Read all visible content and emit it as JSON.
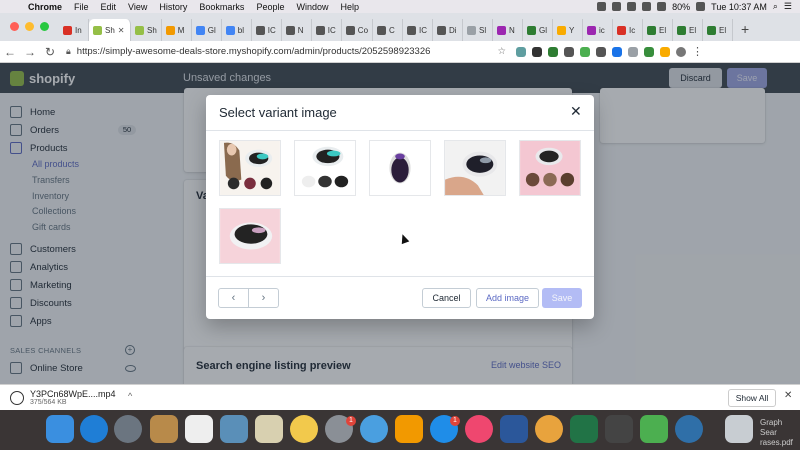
{
  "menubar": {
    "app": "Chrome",
    "items": [
      "File",
      "Edit",
      "View",
      "History",
      "Bookmarks",
      "People",
      "Window",
      "Help"
    ],
    "battery": "80%",
    "clock": "Tue 10:37 AM"
  },
  "browser": {
    "tabs": [
      {
        "label": "In",
        "color": "#d93025"
      },
      {
        "label": "Sh",
        "color": "#95bf47",
        "active": true
      },
      {
        "label": "Sh",
        "color": "#95bf47"
      },
      {
        "label": "M",
        "color": "#f29900"
      },
      {
        "label": "Gl",
        "color": "#4285f4"
      },
      {
        "label": "bl",
        "color": "#4285f4"
      },
      {
        "label": "IC",
        "color": "#555555"
      },
      {
        "label": "N",
        "color": "#555555"
      },
      {
        "label": "IC",
        "color": "#555555"
      },
      {
        "label": "Co",
        "color": "#555555"
      },
      {
        "label": "C",
        "color": "#555555"
      },
      {
        "label": "IC",
        "color": "#555555"
      },
      {
        "label": "Di",
        "color": "#555555"
      },
      {
        "label": "Sl",
        "color": "#9aa0a6"
      },
      {
        "label": "N",
        "color": "#9c27b0"
      },
      {
        "label": "Gl",
        "color": "#2e7d32"
      },
      {
        "label": "Y",
        "color": "#f9ab00"
      },
      {
        "label": "ic",
        "color": "#9c27b0"
      },
      {
        "label": "Ic",
        "color": "#d93025"
      },
      {
        "label": "El",
        "color": "#2e7d32"
      },
      {
        "label": "El",
        "color": "#2e7d32"
      },
      {
        "label": "El",
        "color": "#2e7d32"
      }
    ],
    "url": "https://simply-awesome-deals-store.myshopify.com/admin/products/2052598923326"
  },
  "shopify": {
    "logo": "shopify",
    "header_status": "Unsaved changes",
    "discard": "Discard",
    "save": "Save",
    "nav": {
      "home": "Home",
      "orders": "Orders",
      "orders_count": "50",
      "products": "Products",
      "all_products": "All products",
      "transfers": "Transfers",
      "inventory": "Inventory",
      "collections": "Collections",
      "gift_cards": "Gift cards",
      "customers": "Customers",
      "analytics": "Analytics",
      "marketing": "Marketing",
      "discounts": "Discounts",
      "apps": "Apps",
      "sales_channels": "SALES CHANNELS",
      "online_store": "Online Store"
    },
    "variants_heading": "Va",
    "seo_title": "Search engine listing preview",
    "seo_link": "Edit website SEO"
  },
  "modal": {
    "title": "Select variant image",
    "cancel": "Cancel",
    "add_image": "Add image",
    "save": "Save",
    "images": [
      {
        "name": "hair-model-brushes"
      },
      {
        "name": "three-brushes-teal"
      },
      {
        "name": "brush-oval-dark"
      },
      {
        "name": "brush-in-hand"
      },
      {
        "name": "brush-pink-collage"
      },
      {
        "name": "brush-pink-background"
      }
    ]
  },
  "download": {
    "filename": "Y3PCn68WpE....mp4",
    "progress": "375/564 KB",
    "show_all": "Show All"
  },
  "dock": {
    "badges": [
      "1",
      "1"
    ],
    "desktop_text": "Graph Sear rases.pdf"
  }
}
